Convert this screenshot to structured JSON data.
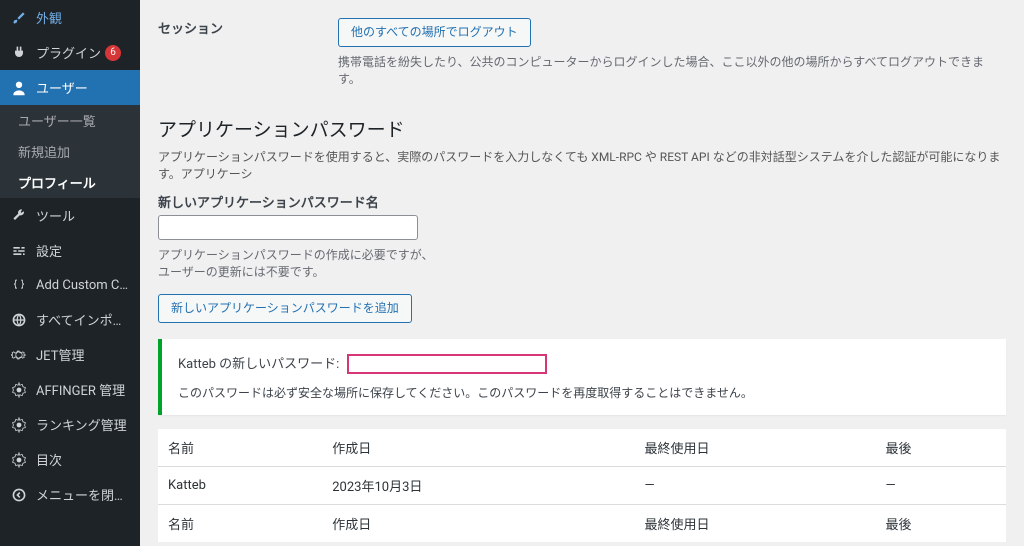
{
  "sidebar": {
    "items": [
      {
        "label": "外観",
        "icon": "brush"
      },
      {
        "label": "プラグイン",
        "icon": "plug",
        "badge": "6"
      },
      {
        "label": "ユーザー",
        "icon": "user",
        "current": true
      },
      {
        "label": "ツール",
        "icon": "wrench"
      },
      {
        "label": "設定",
        "icon": "sliders"
      },
      {
        "label": "Add Custom CSS",
        "icon": "braces"
      },
      {
        "label": "すべてインポート",
        "icon": "globe"
      },
      {
        "label": "JET管理",
        "icon": "gear"
      },
      {
        "label": "AFFINGER 管理",
        "icon": "gear"
      },
      {
        "label": "ランキング管理",
        "icon": "gear"
      },
      {
        "label": "目次",
        "icon": "gear"
      },
      {
        "label": "メニューを閉じる",
        "icon": "collapse"
      }
    ],
    "sub": [
      {
        "label": "ユーザー一覧"
      },
      {
        "label": "新規追加"
      },
      {
        "label": "プロフィール",
        "current": true
      }
    ]
  },
  "session": {
    "label": "セッション",
    "button": "他のすべての場所でログアウト",
    "desc": "携帯電話を紛失したり、公共のコンピューターからログインした場合、ここ以外の他の場所からすべてログアウトできます。"
  },
  "app_pw": {
    "heading": "アプリケーションパスワード",
    "help": "アプリケーションパスワードを使用すると、実際のパスワードを入力しなくても XML-RPC や REST API などの非対話型システムを介した認証が可能になります。アプリケーシ",
    "name_label": "新しいアプリケーションパスワード名",
    "name_help1": "アプリケーションパスワードの作成に必要ですが、",
    "name_help2": "ユーザーの更新には不要です。",
    "add_button": "新しいアプリケーションパスワードを追加",
    "notice_prefix": "Katteb の新しいパスワード:",
    "notice_help": "このパスワードは必ず安全な場所に保存してください。このパスワードを再度取得することはできません。"
  },
  "table": {
    "th_name": "名前",
    "th_created": "作成日",
    "th_last_used": "最終使用日",
    "th_last_ip": "最後",
    "rows": [
      {
        "name": "Katteb",
        "created": "2023年10月3日",
        "last_used": "—",
        "last_ip": "—"
      }
    ]
  }
}
